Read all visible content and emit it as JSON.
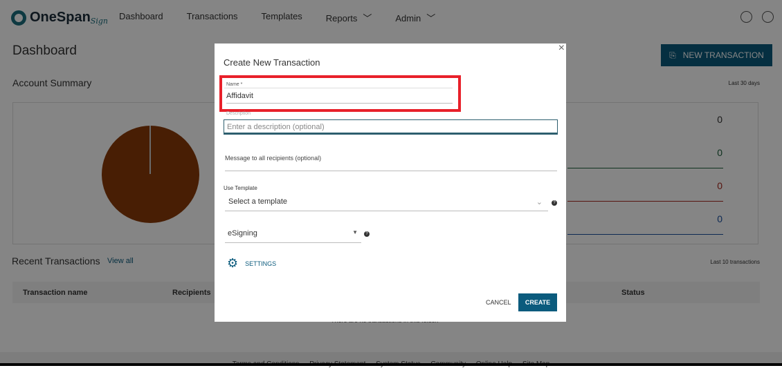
{
  "app": {
    "brand": "OneSpan",
    "brand_suffix": "Sign"
  },
  "nav": {
    "items": [
      "Dashboard",
      "Transactions",
      "Templates",
      "Reports",
      "Admin"
    ]
  },
  "page": {
    "title": "Dashboard",
    "new_transaction": "NEW TRANSACTION"
  },
  "summary": {
    "title": "Account Summary",
    "period": "Last 30 days",
    "counts": [
      "0",
      "0",
      "0",
      "0"
    ],
    "count_colors": [
      "#333333",
      "#1b5e3a",
      "#a8281e",
      "#1a4fa0"
    ],
    "pie_color": "#8a3a08"
  },
  "recent": {
    "title": "Recent Transactions",
    "view_all": "View all",
    "period": "Last 10 transactions",
    "columns": [
      "Transaction name",
      "Recipients",
      "Status"
    ],
    "empty": "There are no transactions in this folder."
  },
  "footer": {
    "links": [
      "Terms and Conditions",
      "Privacy Statement",
      "System Status",
      "Community",
      "Online Help",
      "Site Map"
    ]
  },
  "modal": {
    "title": "Create New Transaction",
    "name_label": "Name *",
    "name_value": "Affidavit",
    "description_label": "Description",
    "description_placeholder": "Enter a description (optional)",
    "message_placeholder": "Message to all recipients (optional)",
    "template_label": "Use Template",
    "template_value": "Select a template",
    "type_value": "eSigning",
    "settings": "SETTINGS",
    "cancel": "CANCEL",
    "create": "CREATE",
    "close": "×"
  }
}
